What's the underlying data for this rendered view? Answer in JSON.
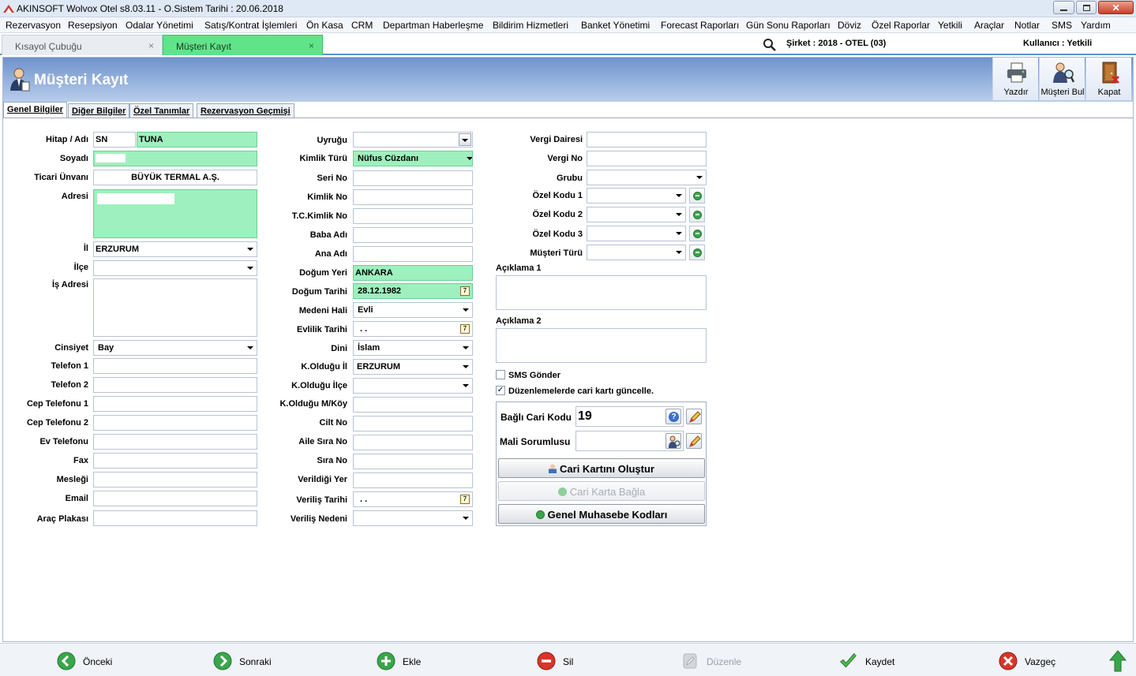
{
  "window": {
    "title": "AKINSOFT Wolvox Otel s8.03.11 - O.Sistem Tarihi : 20.06.2018"
  },
  "menu": [
    "Rezervasyon",
    "Resepsiyon",
    "Odalar Yönetimi",
    "Satış/Kontrat İşlemleri",
    "Ön Kasa",
    "CRM",
    "Departman Haberleşme",
    "Bildirim Hizmetleri",
    "Banket Yönetimi",
    "Forecast Raporları",
    "Gün Sonu Raporları",
    "Döviz",
    "Özel Raporlar",
    "Yetkili",
    "Araçlar",
    "Notlar",
    "SMS",
    "Yardım"
  ],
  "doc_tabs": [
    {
      "label": "Kısayol Çubuğu"
    },
    {
      "label": "Müşteri Kayıt"
    }
  ],
  "info": {
    "sirket": "Şirket : 2018 - OTEL (03)",
    "kullanici": "Kullanıcı : Yetkili"
  },
  "header": {
    "title": "Müşteri Kayıt",
    "buttons": [
      "Yazdır",
      "Müşteri Bul",
      "Kapat"
    ]
  },
  "sub_tabs": [
    "Genel Bilgiler",
    "Diğer Bilgiler",
    "Özel Tanımlar",
    "Rezervasyon Geçmişi"
  ],
  "col1": {
    "labels": {
      "hitap": "Hitap / Adı",
      "soyadi": "Soyadı",
      "ticari": "Ticari Ünvanı",
      "adresi": "Adresi",
      "il": "İl",
      "ilce": "İlçe",
      "is_adresi": "İş Adresi",
      "cinsiyet": "Cinsiyet",
      "tel1": "Telefon 1",
      "tel2": "Telefon 2",
      "cep1": "Cep Telefonu 1",
      "cep2": "Cep Telefonu 2",
      "ev": "Ev Telefonu",
      "fax": "Fax",
      "meslek": "Mesleği",
      "email": "Email",
      "plaka": "Araç Plakası"
    },
    "values": {
      "hitap": "SN",
      "adi": "TUNA",
      "ticari": "BÜYÜK TERMAL A.Ş.",
      "il": "ERZURUM",
      "cinsiyet": "Bay"
    }
  },
  "col2": {
    "labels": {
      "uyruk": "Uyruğu",
      "kimlik_turu": "Kimlik Türü",
      "seri": "Seri No",
      "kimlik_no": "Kimlik No",
      "tc": "T.C.Kimlik No",
      "baba": "Baba Adı",
      "ana": "Ana Adı",
      "dogum_yeri": "Doğum Yeri",
      "dogum_tarihi": "Doğum Tarihi",
      "medeni": "Medeni Hali",
      "evlilik": "Evlilik Tarihi",
      "dini": "Dini",
      "k_il": "K.Olduğu İl",
      "k_ilce": "K.Olduğu İlçe",
      "k_mkoy": "K.Olduğu M/Köy",
      "cilt": "Cilt No",
      "aile": "Aile Sıra No",
      "sira": "Sıra No",
      "verildigi": "Verildiği Yer",
      "verilis_tarihi": "Veriliş Tarihi",
      "verilis_nedeni": "Veriliş Nedeni"
    },
    "values": {
      "kimlik_turu": "Nüfus Cüzdanı",
      "dogum_yeri": "ANKARA",
      "dogum_tarihi": "28.12.1982",
      "medeni": "Evli",
      "evlilik": ". .",
      "dini": "İslam",
      "k_il": "ERZURUM",
      "verilis_tarihi": ". ."
    }
  },
  "col3": {
    "labels": {
      "vergi_d": "Vergi Dairesi",
      "vergi_no": "Vergi No",
      "grubu": "Grubu",
      "ozel1": "Özel Kodu 1",
      "ozel2": "Özel Kodu 2",
      "ozel3": "Özel Kodu 3",
      "musteri_turu": "Müşteri Türü",
      "aciklama1": "Açıklama 1",
      "aciklama2": "Açıklama 2",
      "sms": "SMS Gönder",
      "duzenle": "Düzenlemelerde cari kartı güncelle.",
      "bagli_cari": "Bağlı Cari Kodu",
      "mali": "Mali Sorumlusu"
    },
    "values": {
      "bagli_cari": "19",
      "sms_checked": false,
      "duzenle_checked": true
    },
    "buttons": {
      "olustur": "Cari Kartını Oluştur",
      "bagla": "Cari Karta Bağla",
      "muhasebe": "Genel Muhasebe Kodları"
    }
  },
  "footer": {
    "onceki": "Önceki",
    "sonraki": "Sonraki",
    "ekle": "Ekle",
    "sil": "Sil",
    "duzenle": "Düzenle",
    "kaydet": "Kaydet",
    "vazgec": "Vazgeç"
  },
  "colors": {
    "header": "#7d9fd4",
    "green_field": "#9ef0be",
    "active_tab": "#60e48a"
  }
}
